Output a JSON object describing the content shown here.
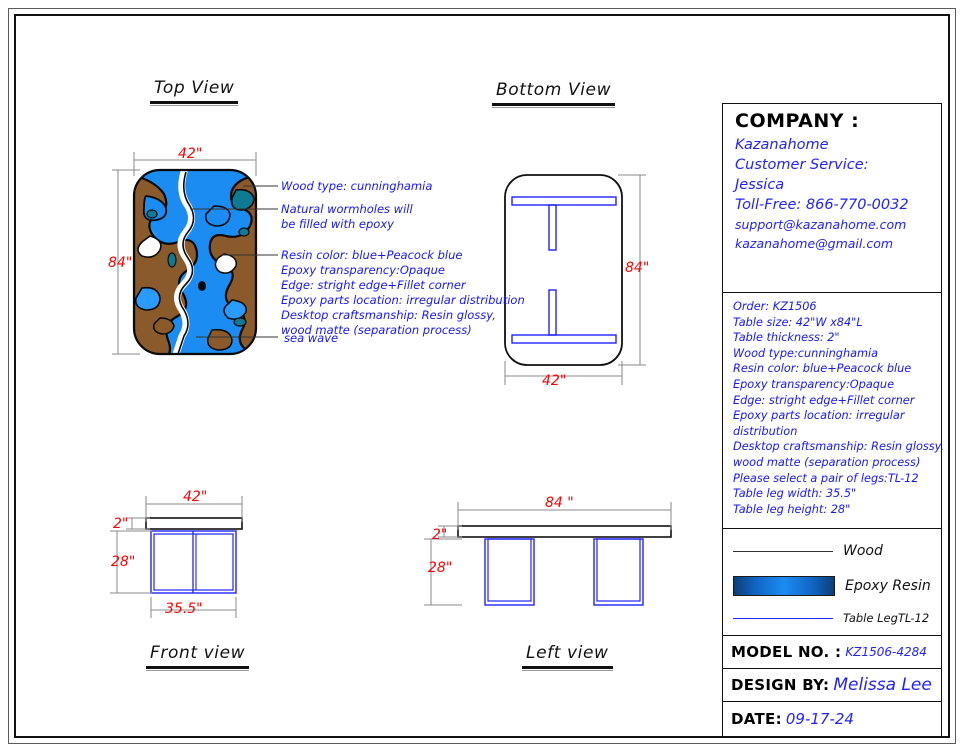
{
  "views": {
    "top": "Top View",
    "bottom": "Bottom View",
    "front": "Front view",
    "left": "Left view"
  },
  "dimensions": {
    "top_width": "42\"",
    "top_height": "84\"",
    "bottom_width": "42\"",
    "bottom_height": "84\"",
    "front_width": "42\"",
    "front_thickness": "2\"",
    "front_leg_height": "28\"",
    "front_leg_width": "35.5\"",
    "left_width": "84 \"",
    "left_thickness": "2\"",
    "left_leg_height": "28\""
  },
  "top_view_notes": {
    "n1": "Wood type: cunninghamia",
    "n2a": "Natural wormholes will",
    "n2b": "be filled with epoxy",
    "n3a": "Resin color: blue+Peacock blue",
    "n3b": "Epoxy transparency:Opaque",
    "n3c": "Edge: stright edge+Fillet corner",
    "n3d": "Epoxy parts location: irregular distribution",
    "n3e": "Desktop craftsmanship: Resin glossy,",
    "n3f": "wood matte (separation process)",
    "n4": "sea wave"
  },
  "title_block": {
    "company_heading": "COMPANY :",
    "company_lines": [
      "Kazanahome",
      "Customer Service:",
      "Jessica",
      "Toll-Free: 866-770-0032"
    ],
    "company_lines_small": [
      "support@kazanahome.com",
      "kazanahome@gmail.com"
    ],
    "specs": [
      "Order: KZ1506",
      "Table size: 42\"W x84\"L",
      "Table thickness: 2\"",
      "Wood type:cunninghamia",
      "Resin color: blue+Peacock blue",
      "Epoxy transparency:Opaque",
      "Edge: stright edge+Fillet corner",
      "Epoxy parts location: irregular",
      "distribution",
      "Desktop craftsmanship: Resin glossy,",
      "wood matte (separation process)",
      "Please select a pair of legs:TL-12",
      "Table leg width: 35.5\"",
      "Table leg height: 28\""
    ],
    "legend": [
      {
        "label": "Wood",
        "swatch": "line-black"
      },
      {
        "label": "Epoxy Resin",
        "swatch": "gradient-blue"
      },
      {
        "label": "Table LegTL-12",
        "swatch": "line-blue"
      }
    ],
    "fields": [
      {
        "key": "MODEL  NO. :",
        "value": "KZ1506-4284"
      },
      {
        "key": "DESIGN BY:",
        "value": "Melissa Lee"
      },
      {
        "key": "DATE:",
        "value": "09-17-24"
      }
    ]
  },
  "colors": {
    "wood": "#8B5A2B",
    "resin_blue": "#1b8cf2",
    "resin_dark": "#0c3f78",
    "peacock": "#0e7b92",
    "leg_blue": "#2222ff",
    "dimension_red": "#ff0000",
    "note_blue": "#1616ff",
    "line_black": "#111111",
    "dim_line_gray": "#888888"
  }
}
